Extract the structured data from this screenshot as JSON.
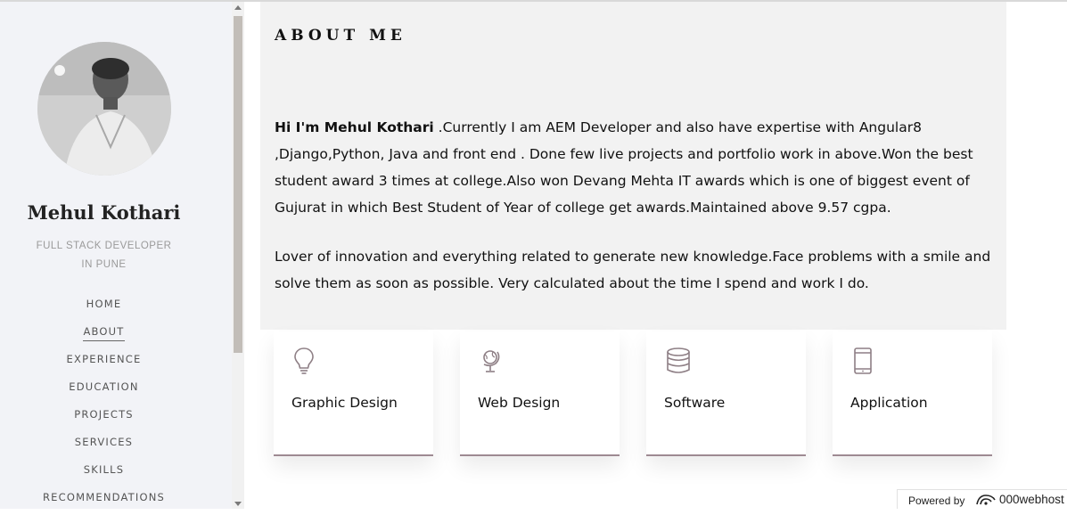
{
  "sidebar": {
    "name": "Mehul Kothari",
    "role_line1": "FULL STACK DEVELOPER",
    "role_line2": "IN PUNE",
    "nav": [
      {
        "label": "HOME"
      },
      {
        "label": "ABOUT",
        "active": true
      },
      {
        "label": "EXPERIENCE"
      },
      {
        "label": "EDUCATION"
      },
      {
        "label": "PROJECTS"
      },
      {
        "label": "SERVICES"
      },
      {
        "label": "SKILLS"
      },
      {
        "label": "RECOMMENDATIONS"
      }
    ]
  },
  "about": {
    "heading": "ABOUT ME",
    "intro_bold": "Hi I'm Mehul Kothari",
    "intro_rest": " .Currently I am AEM Developer and also have expertise with Angular8 ,Django,Python, Java and front end . Done few live projects and portfolio work in above.Won the best student award 3 times at college.Also won Devang Mehta IT awards which is one of biggest event of Gujurat in which Best Student of Year of college get awards.Maintained above 9.57 cgpa.",
    "para2": "Lover of innovation and everything related to generate new knowledge.Face problems with a smile and solve them as soon as possible. Very calculated about the time I spend and work I do."
  },
  "services": [
    {
      "label": "Graphic Design",
      "icon": "lightbulb-icon"
    },
    {
      "label": "Web Design",
      "icon": "globe-icon"
    },
    {
      "label": "Software",
      "icon": "database-icon"
    },
    {
      "label": "Application",
      "icon": "phone-icon"
    }
  ],
  "badge": {
    "powered": "Powered by",
    "brand": "000webhost"
  },
  "colors": {
    "sidebar_bg": "#f2f3f7",
    "about_bg": "#f2f2f2",
    "card_accent": "#9e8a92",
    "icon_color": "#8e7f85"
  }
}
